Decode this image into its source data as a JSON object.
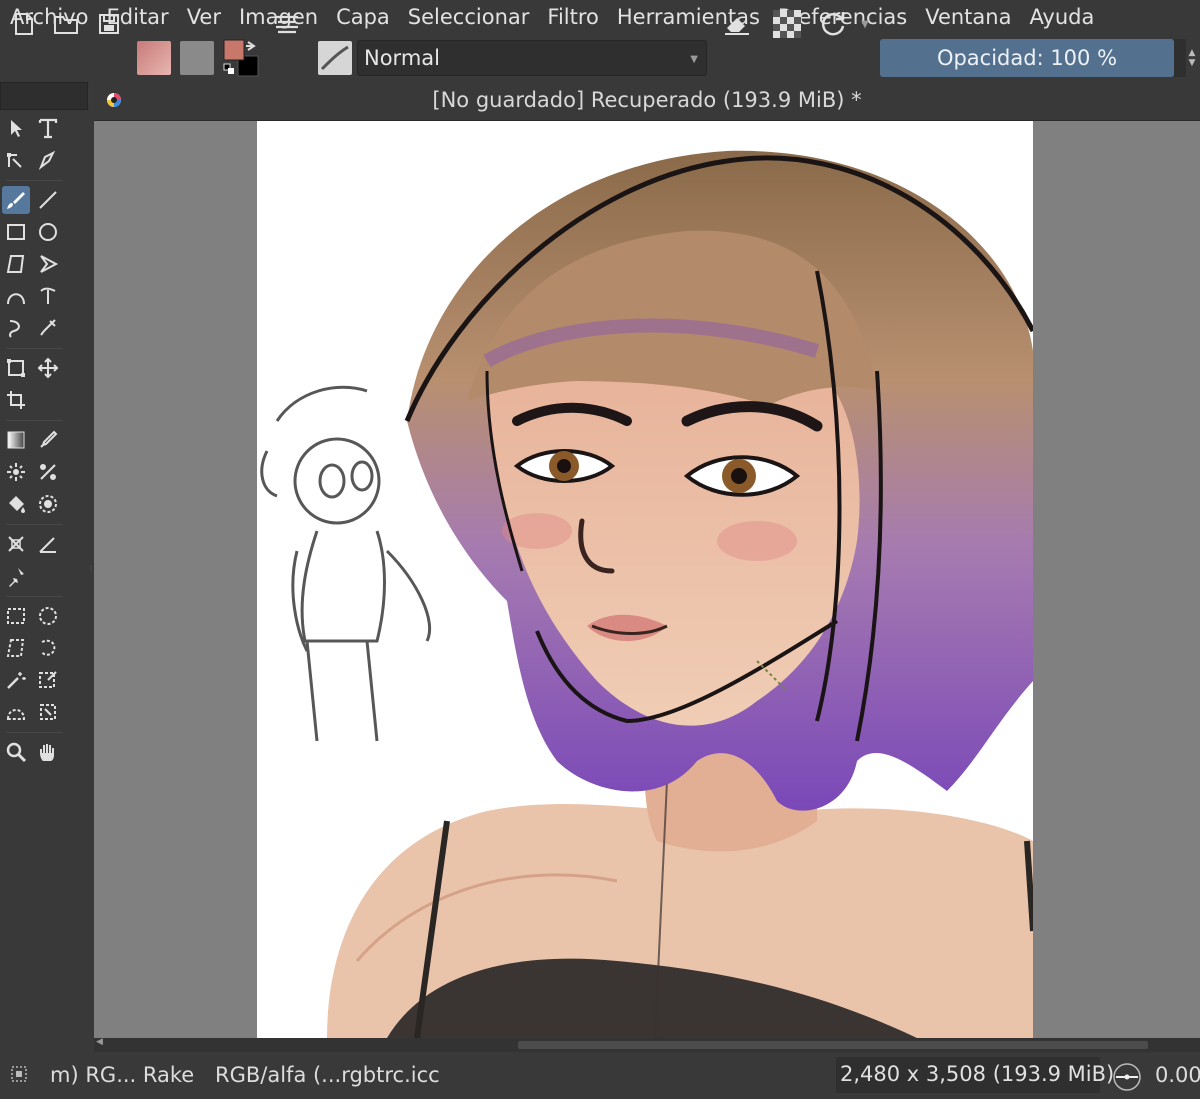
{
  "menubar": {
    "items": [
      "Archivo",
      "Editar",
      "Ver",
      "Imagen",
      "Capa",
      "Seleccionar",
      "Filtro",
      "Herramientas",
      "Preferencias",
      "Ventana",
      "Ayuda"
    ]
  },
  "toolbar": {
    "blend_mode": "Normal",
    "opacity_label": "Opacidad: 100 %",
    "foreground_color": "#c8786a",
    "background_color": "#000000"
  },
  "document": {
    "tab_title": "[No guardado]  Recuperado (193.9 MiB) *"
  },
  "statusbar": {
    "brush": "m) RG... Rake",
    "color_profile": "RGB/alfa (...rgbtrc.icc",
    "dimensions": "2,480 x 3,508 (193.9 MiB)",
    "rotation": "0.00"
  },
  "colors": {
    "accent": "#53718f",
    "active_tool": "#56789c"
  }
}
